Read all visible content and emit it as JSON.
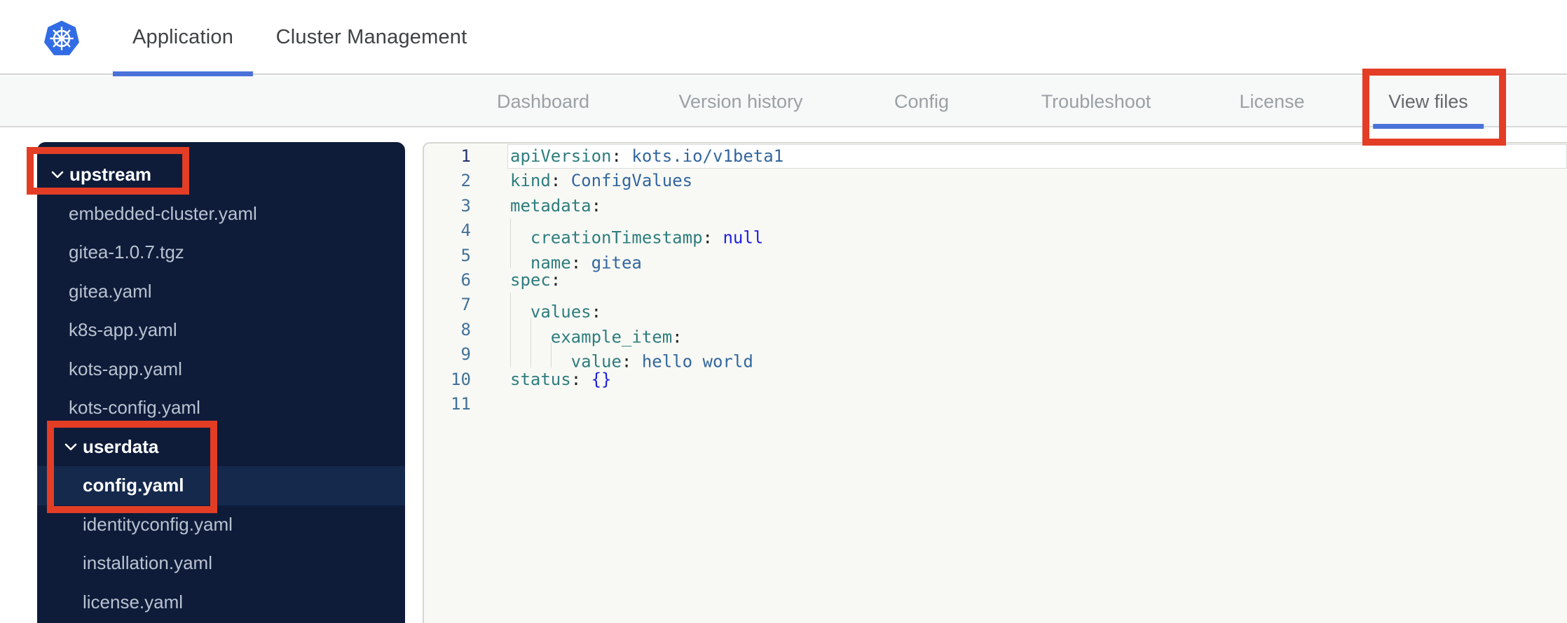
{
  "header": {
    "tabs": [
      {
        "label": "Application",
        "active": true
      },
      {
        "label": "Cluster Management",
        "active": false
      }
    ]
  },
  "subnav": {
    "tabs": [
      {
        "label": "Dashboard",
        "active": false
      },
      {
        "label": "Version history",
        "active": false
      },
      {
        "label": "Config",
        "active": false
      },
      {
        "label": "Troubleshoot",
        "active": false
      },
      {
        "label": "License",
        "active": false
      },
      {
        "label": "View files",
        "active": true
      }
    ]
  },
  "file_tree": {
    "items": [
      {
        "label": "upstream",
        "type": "folder",
        "level": 1,
        "expanded": true,
        "selected": false
      },
      {
        "label": "embedded-cluster.yaml",
        "type": "file",
        "level": 1,
        "selected": false
      },
      {
        "label": "gitea-1.0.7.tgz",
        "type": "file",
        "level": 1,
        "selected": false
      },
      {
        "label": "gitea.yaml",
        "type": "file",
        "level": 1,
        "selected": false
      },
      {
        "label": "k8s-app.yaml",
        "type": "file",
        "level": 1,
        "selected": false
      },
      {
        "label": "kots-app.yaml",
        "type": "file",
        "level": 1,
        "selected": false
      },
      {
        "label": "kots-config.yaml",
        "type": "file",
        "level": 1,
        "selected": false
      },
      {
        "label": "userdata",
        "type": "folder",
        "level": 2,
        "expanded": true,
        "selected": false
      },
      {
        "label": "config.yaml",
        "type": "file",
        "level": 2,
        "selected": true
      },
      {
        "label": "identityconfig.yaml",
        "type": "file",
        "level": 2,
        "selected": false
      },
      {
        "label": "installation.yaml",
        "type": "file",
        "level": 2,
        "selected": false
      },
      {
        "label": "license.yaml",
        "type": "file",
        "level": 2,
        "selected": false
      }
    ]
  },
  "editor": {
    "active_line": 1,
    "lines": [
      {
        "n": 1,
        "tokens": [
          {
            "t": "key",
            "v": "apiVersion"
          },
          {
            "t": "punc",
            "v": ": "
          },
          {
            "t": "str",
            "v": "kots.io/v1beta1"
          }
        ]
      },
      {
        "n": 2,
        "tokens": [
          {
            "t": "key",
            "v": "kind"
          },
          {
            "t": "punc",
            "v": ": "
          },
          {
            "t": "str",
            "v": "ConfigValues"
          }
        ]
      },
      {
        "n": 3,
        "tokens": [
          {
            "t": "key",
            "v": "metadata"
          },
          {
            "t": "punc",
            "v": ":"
          }
        ]
      },
      {
        "n": 4,
        "tokens": [
          {
            "t": "sp"
          },
          {
            "t": "key",
            "v": "creationTimestamp"
          },
          {
            "t": "punc",
            "v": ": "
          },
          {
            "t": "kw",
            "v": "null"
          }
        ]
      },
      {
        "n": 5,
        "tokens": [
          {
            "t": "sp"
          },
          {
            "t": "key",
            "v": "name"
          },
          {
            "t": "punc",
            "v": ": "
          },
          {
            "t": "str",
            "v": "gitea"
          }
        ]
      },
      {
        "n": 6,
        "tokens": [
          {
            "t": "key",
            "v": "spec"
          },
          {
            "t": "punc",
            "v": ":"
          }
        ]
      },
      {
        "n": 7,
        "tokens": [
          {
            "t": "sp"
          },
          {
            "t": "key",
            "v": "values"
          },
          {
            "t": "punc",
            "v": ":"
          }
        ]
      },
      {
        "n": 8,
        "tokens": [
          {
            "t": "sp"
          },
          {
            "t": "sp"
          },
          {
            "t": "key",
            "v": "example_item"
          },
          {
            "t": "punc",
            "v": ":"
          }
        ]
      },
      {
        "n": 9,
        "tokens": [
          {
            "t": "sp"
          },
          {
            "t": "sp"
          },
          {
            "t": "sp"
          },
          {
            "t": "key",
            "v": "value"
          },
          {
            "t": "punc",
            "v": ": "
          },
          {
            "t": "str",
            "v": "hello world"
          }
        ]
      },
      {
        "n": 10,
        "tokens": [
          {
            "t": "key",
            "v": "status"
          },
          {
            "t": "punc",
            "v": ": "
          },
          {
            "t": "kw",
            "v": "{}"
          }
        ]
      },
      {
        "n": 11,
        "tokens": []
      }
    ]
  },
  "annotations": [
    {
      "target": "upstream folder row"
    },
    {
      "target": "userdata folder row and config.yaml row"
    },
    {
      "target": "View files tab"
    }
  ],
  "colors": {
    "brand_blue": "#4a72d8",
    "kubernetes_blue": "#326ce5",
    "annotation_red": "#e33d26",
    "sidebar_bg": "#0e1c3a",
    "sidebar_selected_row": "#15294d",
    "code_key": "#2e7d7d",
    "code_string": "#33669e",
    "code_keyword": "#1e1ee0"
  },
  "icons": {
    "logo": "kubernetes-logo",
    "folder_chevron": "chevron-down-icon"
  }
}
